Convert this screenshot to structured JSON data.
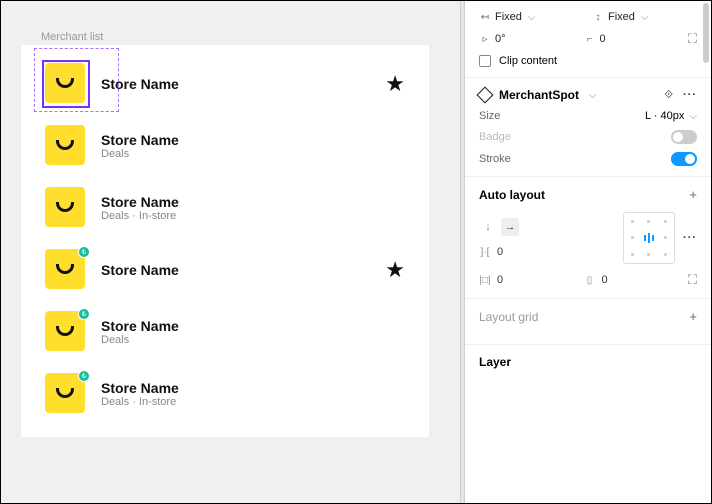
{
  "frame": {
    "label": "Merchant list"
  },
  "merchants": [
    {
      "name": "Store Name"
    },
    {
      "name": "Store Name",
      "sub": "Deals"
    },
    {
      "name": "Store Name",
      "sub": "Deals · In-store"
    },
    {
      "name": "Store Name"
    },
    {
      "name": "Store Name",
      "sub": "Deals"
    },
    {
      "name": "Store Name",
      "sub": "Deals · In-store"
    }
  ],
  "inspector": {
    "hConstraint": "Fixed",
    "vConstraint": "Fixed",
    "rotation": "0°",
    "cornerRadius": "0",
    "clipLabel": "Clip content",
    "componentName": "MerchantSpot",
    "sizeLabel": "Size",
    "sizeValue": "L · 40px",
    "badgeLabel": "Badge",
    "strokeLabel": "Stroke",
    "autoLayout": {
      "title": "Auto layout",
      "spacing": "0",
      "paddingH": "0",
      "paddingV": "0"
    },
    "layoutGrid": "Layout grid",
    "layer": "Layer"
  }
}
